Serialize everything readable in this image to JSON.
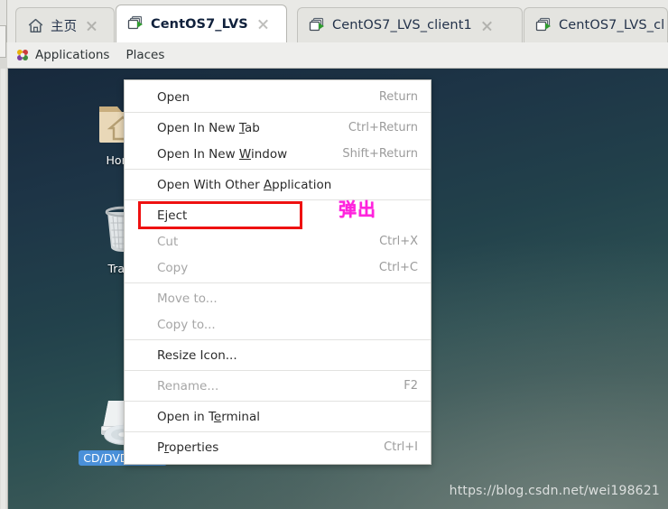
{
  "window": {
    "tabs": [
      {
        "label": "主页",
        "icon": "home-icon",
        "active": false,
        "closable": true
      },
      {
        "label": "CentOS7_LVS",
        "icon": "vm-icon",
        "active": true,
        "closable": true
      },
      {
        "label": "CentOS7_LVS_client1",
        "icon": "vm-icon",
        "active": false,
        "closable": true
      },
      {
        "label": "CentOS7_LVS_cl",
        "icon": "vm-icon",
        "active": false,
        "closable": false
      }
    ]
  },
  "gnome_panel": {
    "applications_label": "Applications",
    "places_label": "Places",
    "foot_icon": "gnome-foot-icon"
  },
  "desktop": {
    "icons": [
      {
        "label": "Home",
        "icon": "home-folder-icon",
        "selected": false
      },
      {
        "label": "Trash",
        "icon": "trash-icon",
        "selected": false
      },
      {
        "label": "CD/DVD Drive",
        "icon": "cd-drive-icon",
        "selected": true
      }
    ],
    "watermark": "https://blog.csdn.net/wei198621"
  },
  "context_menu": {
    "items": [
      {
        "label": "Open",
        "accel": "Return",
        "disabled": false,
        "underline_index": -1,
        "separator_after": true
      },
      {
        "label": "Open In New Tab",
        "accel": "Ctrl+Return",
        "disabled": false,
        "underline_index": 12,
        "separator_after": false
      },
      {
        "label": "Open In New Window",
        "accel": "Shift+Return",
        "disabled": false,
        "underline_index": 12,
        "separator_after": true
      },
      {
        "label": "Open With Other Application",
        "accel": "",
        "disabled": false,
        "underline_index": 16,
        "separator_after": true
      },
      {
        "label": "Eject",
        "accel": "",
        "disabled": false,
        "underline_index": 1,
        "separator_after": false,
        "highlighted": true
      },
      {
        "label": "Cut",
        "accel": "Ctrl+X",
        "disabled": true,
        "underline_index": -1,
        "separator_after": false
      },
      {
        "label": "Copy",
        "accel": "Ctrl+C",
        "disabled": true,
        "underline_index": -1,
        "separator_after": true
      },
      {
        "label": "Move to...",
        "accel": "",
        "disabled": true,
        "underline_index": -1,
        "separator_after": false
      },
      {
        "label": "Copy to...",
        "accel": "",
        "disabled": true,
        "underline_index": -1,
        "separator_after": true
      },
      {
        "label": "Resize Icon...",
        "accel": "",
        "disabled": false,
        "underline_index": -1,
        "separator_after": true
      },
      {
        "label": "Rename...",
        "accel": "F2",
        "disabled": true,
        "underline_index": -1,
        "separator_after": true
      },
      {
        "label": "Open in Terminal",
        "accel": "",
        "disabled": false,
        "underline_index": 9,
        "separator_after": true
      },
      {
        "label": "Properties",
        "accel": "Ctrl+I",
        "disabled": false,
        "underline_index": 1,
        "separator_after": false
      }
    ]
  },
  "annotation": {
    "text": "弹出",
    "color": "#ff22dd"
  },
  "colors": {
    "highlight_box": "#ee1111",
    "selection_blue": "#4a90d9",
    "tab_active_bg": "#ffffff",
    "menu_bg": "#ffffff"
  }
}
